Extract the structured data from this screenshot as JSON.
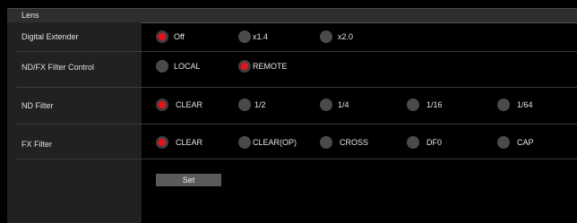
{
  "section": {
    "title": "Lens"
  },
  "rows": {
    "digital_extender": {
      "label": "Digital Extender",
      "options": [
        {
          "label": "Off",
          "selected": true
        },
        {
          "label": "x1.4",
          "selected": false
        },
        {
          "label": "x2.0",
          "selected": false
        }
      ]
    },
    "nd_fx_filter_control": {
      "label": "ND/FX Filter Control",
      "options": [
        {
          "label": "LOCAL",
          "selected": false
        },
        {
          "label": "REMOTE",
          "selected": true
        }
      ]
    },
    "nd_filter": {
      "label": "ND Filter",
      "options": [
        {
          "label": "CLEAR",
          "selected": true
        },
        {
          "label": "1/2",
          "selected": false
        },
        {
          "label": "1/4",
          "selected": false
        },
        {
          "label": "1/16",
          "selected": false
        },
        {
          "label": "1/64",
          "selected": false
        }
      ]
    },
    "fx_filter": {
      "label": "FX Filter",
      "options": [
        {
          "label": "CLEAR",
          "selected": true
        },
        {
          "label": "CLEAR(OP)",
          "selected": false
        },
        {
          "label": "CROSS",
          "selected": false
        },
        {
          "label": "DF0",
          "selected": false
        },
        {
          "label": "CAP",
          "selected": false
        }
      ]
    }
  },
  "buttons": {
    "set_label": "Set"
  },
  "colors": {
    "selected_radio": "#e0141e",
    "header_bg": "#2e2e2e",
    "label_col_bg": "#212121"
  }
}
